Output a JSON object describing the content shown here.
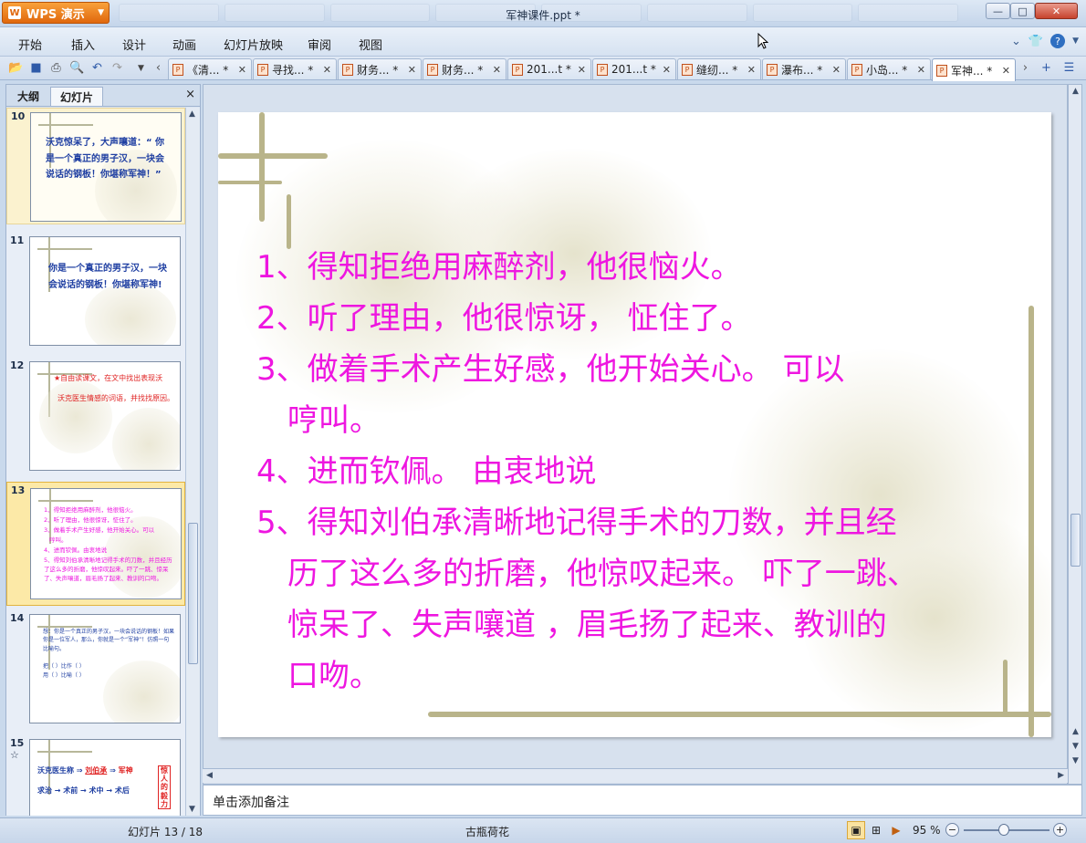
{
  "titlebar": {
    "app_name": "WPS 演示",
    "document_title": "军神课件.ppt *"
  },
  "menu": [
    "开始",
    "插入",
    "设计",
    "动画",
    "幻灯片放映",
    "审阅",
    "视图"
  ],
  "doc_tabs": [
    {
      "label": "《清... *"
    },
    {
      "label": "寻找... *"
    },
    {
      "label": "财务... *"
    },
    {
      "label": "财务... *"
    },
    {
      "label": "201...t *"
    },
    {
      "label": "201...t *"
    },
    {
      "label": "缝纫... *"
    },
    {
      "label": "瀑布... *"
    },
    {
      "label": "小岛... *"
    },
    {
      "label": "军神... *"
    }
  ],
  "left_panel": {
    "tab_outline": "大纲",
    "tab_slides": "幻灯片",
    "close": "×"
  },
  "thumbnails": {
    "s10": {
      "num": "10",
      "text": "沃克惊呆了，大声嚷道：“ 你是一个真正的男子汉，一块会说话的钢板！你堪称军神！”"
    },
    "s11": {
      "num": "11",
      "text": "你是一个真正的男子汉，一块会说话的钢板！你堪称军神!"
    },
    "s12": {
      "num": "12",
      "line1": "★自由读课文，在文中找出表现沃",
      "line2": "沃克医生情感的词语，并找找原因。"
    },
    "s13": {
      "num": "13",
      "lines": [
        "1、得知拒绝用麻醉剂，他很恼火。",
        "2、听了理由，他很惊讶，怔住了。",
        "3、做着手术产生好感，他开始关心。可以",
        "哼叫。",
        "4、进而钦佩。由衷地说",
        "5、得知刘伯承清晰地记得手术的刀数，并且经历了这么多的折磨，他惊叹起来。吓了一跳、惊呆了、失声嚷道，眉毛扬了起来、教训的口吻。"
      ]
    },
    "s14": {
      "num": "14",
      "lines": [
        "想：你是一个真正的男子汉，一块会说话的钢板！如果你是一位军人，那么，你就是一个“军神”！仿照一句比喻句。",
        "把（        ）比作（        ）",
        "用（        ）比喻（        ）"
      ]
    },
    "s15": {
      "num": "15",
      "sub": "☆",
      "row1_a": "沃克医生称",
      "row1_b": "刘伯承",
      "row1_c": "军神",
      "row2": "求治 → 术前 → 术中 → 术后",
      "side": "惊人的毅力"
    }
  },
  "slide": {
    "lines": [
      "1、得知拒绝用麻醉剂，他很恼火。",
      "2、听了理由，他很惊讶， 怔住了。",
      "3、做着手术产生好感，他开始关心。 可以",
      "哼叫。",
      "4、进而钦佩。 由衷地说",
      "5、得知刘伯承清晰地记得手术的刀数，并且经",
      "历了这么多的折磨，他惊叹起来。 吓了一跳、",
      "惊呆了、失声嚷道 ，眉毛扬了起来、教训的",
      "口吻。"
    ]
  },
  "notes_placeholder": "单击添加备注",
  "status": {
    "slide_info": "幻灯片 13 / 18",
    "theme": "古瓶荷花",
    "zoom": "95 %"
  },
  "colors": {
    "slide_text": "#ee16e0",
    "app_button": "#e0680d",
    "thumb_blue": "#1f3fa2",
    "thumb_red": "#e02424"
  }
}
